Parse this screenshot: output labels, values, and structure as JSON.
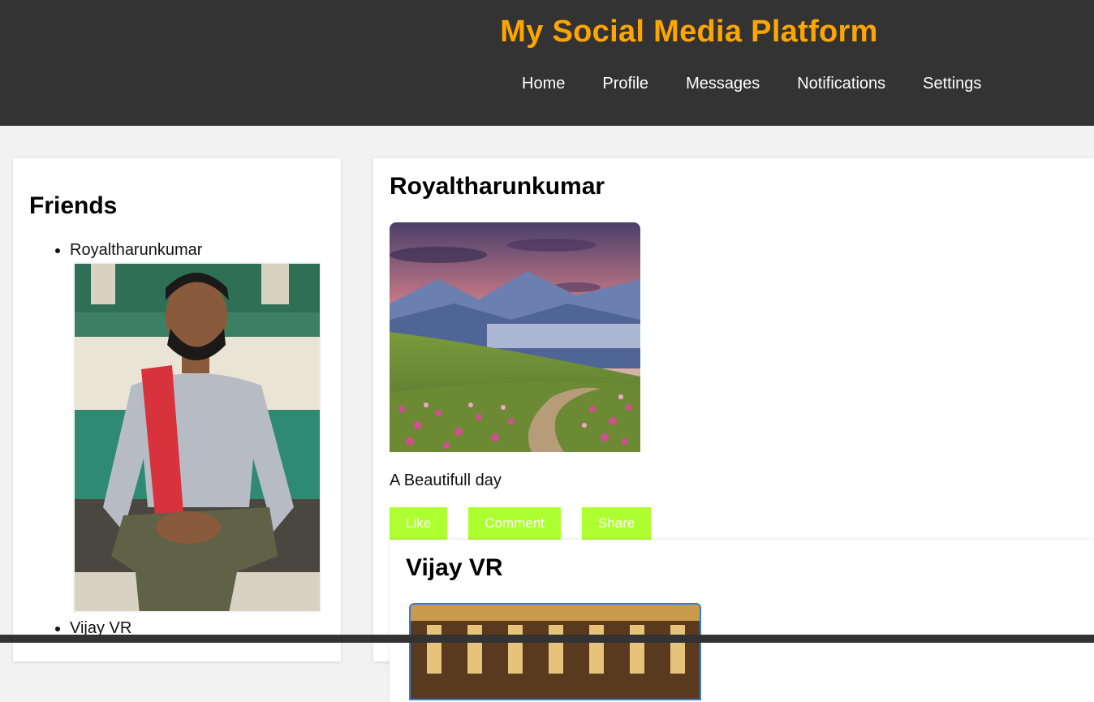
{
  "header": {
    "title": "My Social Media Platform",
    "nav": [
      "Home",
      "Profile",
      "Messages",
      "Notifications",
      "Settings"
    ]
  },
  "friends": {
    "title": "Friends",
    "items": [
      {
        "name": "Royaltharunkumar"
      },
      {
        "name": "Vijay VR"
      }
    ]
  },
  "posts": [
    {
      "author": "Royaltharunkumar",
      "caption": "A Beautifull day",
      "actions": [
        "Like",
        "Comment",
        "Share"
      ]
    },
    {
      "author": "Vijay VR"
    }
  ],
  "colors": {
    "header_bg": "#333333",
    "title": "#ffa500",
    "button_bg": "#adff2f"
  }
}
